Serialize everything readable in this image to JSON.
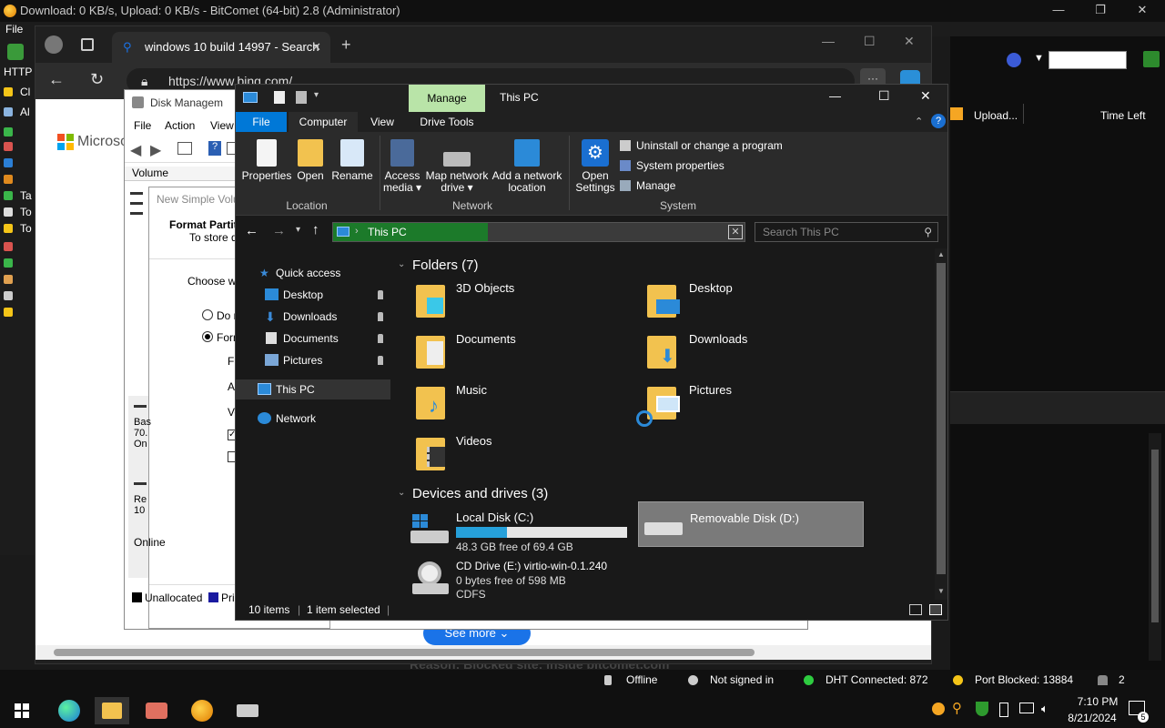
{
  "bitcomet": {
    "title": "Download: 0 KB/s, Upload: 0 KB/s - BitComet (64-bit) 2.8 (Administrator)",
    "menu_file": "File",
    "http_label": "HTTP",
    "columns": {
      "upload": "Upload...",
      "time_left": "Time Left"
    },
    "side_labels": [
      "Cl",
      "Al",
      "Ta",
      "To",
      "To"
    ],
    "status": {
      "offline": "Offline",
      "signin": "Not signed in",
      "dht": "DHT Connected: 872",
      "port": "Port Blocked: 13884",
      "count": "2"
    },
    "reason_text": "Reason: Blocked site: inside bitcomet.com"
  },
  "edge": {
    "tab_title": "windows 10 build 14997 - Search",
    "url": "https://www.bing.com/",
    "brand": "Microso",
    "see_more": "See more"
  },
  "disk_mgmt": {
    "title": "Disk Managem",
    "menu": [
      "File",
      "Action",
      "View"
    ],
    "column_volume": "Volume",
    "wizard_title": "New Simple Volu",
    "wizard_heading": "Format Partiti",
    "wizard_sub": "To store da",
    "wizard_choose": "Choose wh",
    "radio_1": "Do n",
    "radio_2": "Form",
    "field_labels": [
      "Fil",
      "Al",
      "Vo"
    ],
    "disk_rows": [
      "Bas",
      "70.",
      "On",
      "Re",
      "10",
      "Online"
    ],
    "legend_unalloc": "Unallocated",
    "legend_primary": "Pri"
  },
  "explorer": {
    "title": "This PC",
    "manage_tab": "Manage",
    "tabs": [
      "File",
      "Computer",
      "View",
      "Drive Tools"
    ],
    "ribbon": {
      "location": {
        "group": "Location",
        "buttons": [
          "Properties",
          "Open",
          "Rename"
        ]
      },
      "network": {
        "group": "Network",
        "access_media": "Access media ▾",
        "map_drive": "Map network drive ▾",
        "add_location": "Add a network location"
      },
      "system": {
        "group": "System",
        "open_settings": "Open Settings",
        "uninstall": "Uninstall or change a program",
        "sys_props": "System properties",
        "manage": "Manage"
      }
    },
    "address": "This PC",
    "search_placeholder": "Search This PC",
    "nav": {
      "quick_access": "Quick access",
      "desktop": "Desktop",
      "downloads": "Downloads",
      "documents": "Documents",
      "pictures": "Pictures",
      "this_pc": "This PC",
      "network": "Network"
    },
    "folders_header": "Folders (7)",
    "folders": [
      "3D Objects",
      "Desktop",
      "Documents",
      "Downloads",
      "Music",
      "Pictures",
      "Videos"
    ],
    "drives_header": "Devices and drives (3)",
    "drives": {
      "c": {
        "name": "Local Disk (C:)",
        "free": "48.3 GB free of 69.4 GB",
        "used_fraction": 0.3
      },
      "d": {
        "name": "Removable Disk (D:)"
      },
      "e": {
        "name": "CD Drive (E:) virtio-win-0.1.240",
        "free": "0 bytes free of 598 MB",
        "fs": "CDFS"
      }
    },
    "status_items": "10 items",
    "status_selected": "1 item selected"
  },
  "taskbar": {
    "time": "7:10 PM",
    "date": "8/21/2024",
    "notif_count": "5"
  },
  "colors": {
    "accent": "#0078d7",
    "manage_tab": "#b9e4a8",
    "address_fill": "#1c7a2a",
    "selected_drive": "#7a7a7a",
    "folder": "#f2c24f"
  }
}
